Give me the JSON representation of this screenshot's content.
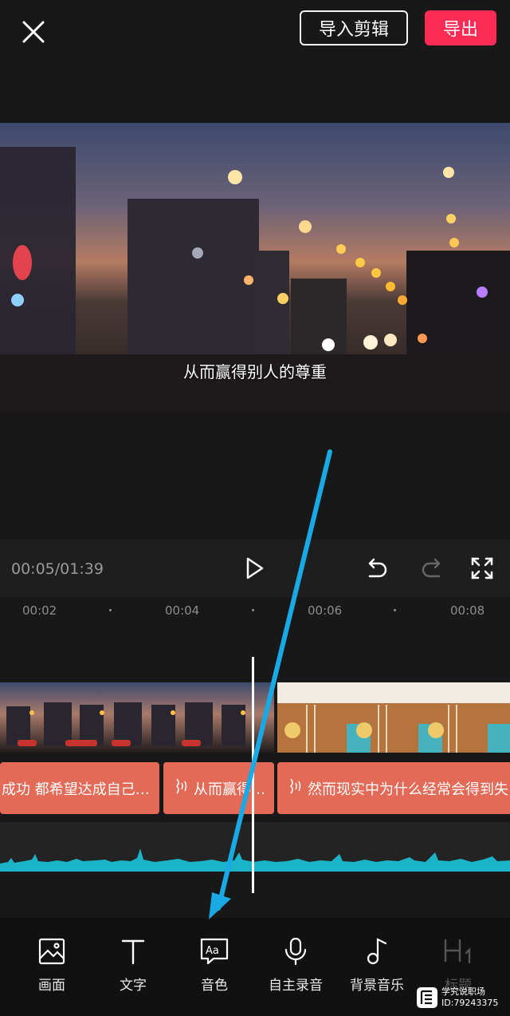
{
  "header": {
    "import_label": "导入剪辑",
    "export_label": "导出"
  },
  "preview": {
    "subtitle": "从而赢得别人的尊重"
  },
  "player": {
    "timecode": "00:05/01:39"
  },
  "ruler": {
    "ticks": [
      "00:02",
      "00:04",
      "00:06",
      "00:08"
    ]
  },
  "subtitles": {
    "clip1": "成功 都希望达成自己的…",
    "clip2": "从而赢得…",
    "clip3": "然而现实中为什么经常会得到失"
  },
  "toolbar": {
    "items": [
      {
        "label": "画面",
        "icon": "image-icon"
      },
      {
        "label": "文字",
        "icon": "text-icon"
      },
      {
        "label": "音色",
        "icon": "voice-tone-icon"
      },
      {
        "label": "自主录音",
        "icon": "microphone-icon"
      },
      {
        "label": "背景音乐",
        "icon": "music-note-icon"
      },
      {
        "label": "标题",
        "icon": "heading-icon"
      }
    ]
  },
  "watermark": {
    "line1": "学究说职场",
    "line2": "ID:79243375"
  },
  "colors": {
    "accent": "#fe2c55",
    "subtitle_clip": "#e26a56",
    "waveform": "#1bb3c7",
    "annotation_arrow": "#19a9e4"
  }
}
